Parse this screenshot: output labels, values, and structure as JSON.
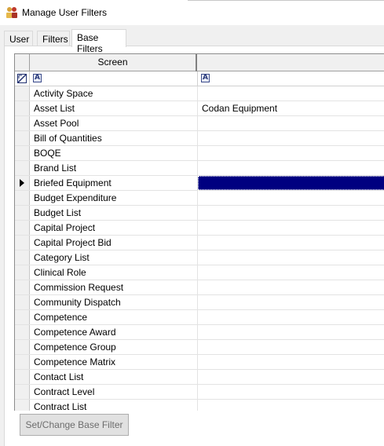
{
  "window": {
    "title": "Manage User Filters"
  },
  "tabs": [
    {
      "label": "User"
    },
    {
      "label": "Filters"
    },
    {
      "label": "Base Filters"
    }
  ],
  "grid": {
    "columns": {
      "screen": "Screen",
      "filter": ""
    },
    "rows": [
      {
        "screen": "Activity Space",
        "filter": ""
      },
      {
        "screen": "Asset List",
        "filter": "Codan Equipment"
      },
      {
        "screen": "Asset Pool",
        "filter": ""
      },
      {
        "screen": "Bill of Quantities",
        "filter": ""
      },
      {
        "screen": "BOQE",
        "filter": ""
      },
      {
        "screen": "Brand List",
        "filter": ""
      },
      {
        "screen": "Briefed Equipment",
        "filter": ""
      },
      {
        "screen": "Budget Expenditure",
        "filter": ""
      },
      {
        "screen": "Budget List",
        "filter": ""
      },
      {
        "screen": "Capital Project",
        "filter": ""
      },
      {
        "screen": "Capital Project Bid",
        "filter": ""
      },
      {
        "screen": "Category List",
        "filter": ""
      },
      {
        "screen": "Clinical Role",
        "filter": ""
      },
      {
        "screen": "Commission Request",
        "filter": ""
      },
      {
        "screen": "Community Dispatch",
        "filter": ""
      },
      {
        "screen": "Competence",
        "filter": ""
      },
      {
        "screen": "Competence Award",
        "filter": ""
      },
      {
        "screen": "Competence Group",
        "filter": ""
      },
      {
        "screen": "Competence Matrix",
        "filter": ""
      },
      {
        "screen": "Contact List",
        "filter": ""
      },
      {
        "screen": "Contract Level",
        "filter": ""
      },
      {
        "screen": "Contract List",
        "filter": ""
      }
    ],
    "filter_icon_letter": "A",
    "current_row_index": 6
  },
  "buttons": {
    "set_change_base_filter": "Set/Change Base Filter"
  },
  "colors": {
    "selection": "#000080",
    "window_bg": "#f0f0f0"
  }
}
